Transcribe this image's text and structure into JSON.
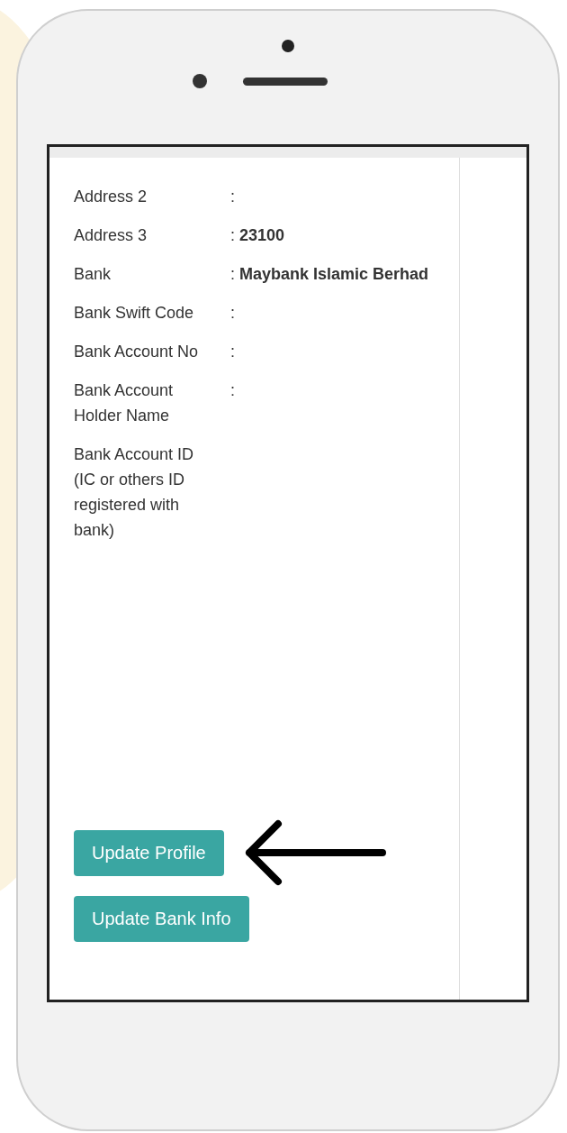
{
  "profile_rows": [
    {
      "label": "Address 2",
      "colon": ":"
    },
    {
      "label": "Address 3",
      "colon": ":",
      "value": "23100"
    },
    {
      "label": "Bank",
      "colon": ":",
      "value": "Maybank Islamic Berhad"
    },
    {
      "label": "Bank Swift Code",
      "colon": ":"
    },
    {
      "label": "Bank Account No",
      "colon": ":"
    },
    {
      "label": "Bank Account Holder Name",
      "colon": ":"
    },
    {
      "label": "Bank Account ID (IC or others ID registered with bank)"
    }
  ],
  "buttons": [
    "Update Profile",
    "Update Bank Info"
  ]
}
